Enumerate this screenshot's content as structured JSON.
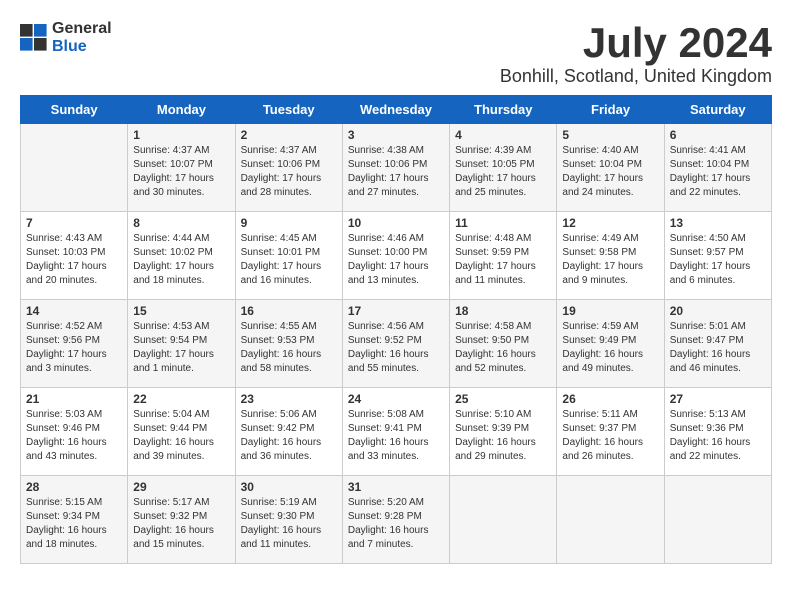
{
  "header": {
    "logo_general": "General",
    "logo_blue": "Blue",
    "month_title": "July 2024",
    "location": "Bonhill, Scotland, United Kingdom"
  },
  "weekdays": [
    "Sunday",
    "Monday",
    "Tuesday",
    "Wednesday",
    "Thursday",
    "Friday",
    "Saturday"
  ],
  "weeks": [
    [
      {
        "day": "",
        "sunrise": "",
        "sunset": "",
        "daylight": ""
      },
      {
        "day": "1",
        "sunrise": "Sunrise: 4:37 AM",
        "sunset": "Sunset: 10:07 PM",
        "daylight": "Daylight: 17 hours and 30 minutes."
      },
      {
        "day": "2",
        "sunrise": "Sunrise: 4:37 AM",
        "sunset": "Sunset: 10:06 PM",
        "daylight": "Daylight: 17 hours and 28 minutes."
      },
      {
        "day": "3",
        "sunrise": "Sunrise: 4:38 AM",
        "sunset": "Sunset: 10:06 PM",
        "daylight": "Daylight: 17 hours and 27 minutes."
      },
      {
        "day": "4",
        "sunrise": "Sunrise: 4:39 AM",
        "sunset": "Sunset: 10:05 PM",
        "daylight": "Daylight: 17 hours and 25 minutes."
      },
      {
        "day": "5",
        "sunrise": "Sunrise: 4:40 AM",
        "sunset": "Sunset: 10:04 PM",
        "daylight": "Daylight: 17 hours and 24 minutes."
      },
      {
        "day": "6",
        "sunrise": "Sunrise: 4:41 AM",
        "sunset": "Sunset: 10:04 PM",
        "daylight": "Daylight: 17 hours and 22 minutes."
      }
    ],
    [
      {
        "day": "7",
        "sunrise": "Sunrise: 4:43 AM",
        "sunset": "Sunset: 10:03 PM",
        "daylight": "Daylight: 17 hours and 20 minutes."
      },
      {
        "day": "8",
        "sunrise": "Sunrise: 4:44 AM",
        "sunset": "Sunset: 10:02 PM",
        "daylight": "Daylight: 17 hours and 18 minutes."
      },
      {
        "day": "9",
        "sunrise": "Sunrise: 4:45 AM",
        "sunset": "Sunset: 10:01 PM",
        "daylight": "Daylight: 17 hours and 16 minutes."
      },
      {
        "day": "10",
        "sunrise": "Sunrise: 4:46 AM",
        "sunset": "Sunset: 10:00 PM",
        "daylight": "Daylight: 17 hours and 13 minutes."
      },
      {
        "day": "11",
        "sunrise": "Sunrise: 4:48 AM",
        "sunset": "Sunset: 9:59 PM",
        "daylight": "Daylight: 17 hours and 11 minutes."
      },
      {
        "day": "12",
        "sunrise": "Sunrise: 4:49 AM",
        "sunset": "Sunset: 9:58 PM",
        "daylight": "Daylight: 17 hours and 9 minutes."
      },
      {
        "day": "13",
        "sunrise": "Sunrise: 4:50 AM",
        "sunset": "Sunset: 9:57 PM",
        "daylight": "Daylight: 17 hours and 6 minutes."
      }
    ],
    [
      {
        "day": "14",
        "sunrise": "Sunrise: 4:52 AM",
        "sunset": "Sunset: 9:56 PM",
        "daylight": "Daylight: 17 hours and 3 minutes."
      },
      {
        "day": "15",
        "sunrise": "Sunrise: 4:53 AM",
        "sunset": "Sunset: 9:54 PM",
        "daylight": "Daylight: 17 hours and 1 minute."
      },
      {
        "day": "16",
        "sunrise": "Sunrise: 4:55 AM",
        "sunset": "Sunset: 9:53 PM",
        "daylight": "Daylight: 16 hours and 58 minutes."
      },
      {
        "day": "17",
        "sunrise": "Sunrise: 4:56 AM",
        "sunset": "Sunset: 9:52 PM",
        "daylight": "Daylight: 16 hours and 55 minutes."
      },
      {
        "day": "18",
        "sunrise": "Sunrise: 4:58 AM",
        "sunset": "Sunset: 9:50 PM",
        "daylight": "Daylight: 16 hours and 52 minutes."
      },
      {
        "day": "19",
        "sunrise": "Sunrise: 4:59 AM",
        "sunset": "Sunset: 9:49 PM",
        "daylight": "Daylight: 16 hours and 49 minutes."
      },
      {
        "day": "20",
        "sunrise": "Sunrise: 5:01 AM",
        "sunset": "Sunset: 9:47 PM",
        "daylight": "Daylight: 16 hours and 46 minutes."
      }
    ],
    [
      {
        "day": "21",
        "sunrise": "Sunrise: 5:03 AM",
        "sunset": "Sunset: 9:46 PM",
        "daylight": "Daylight: 16 hours and 43 minutes."
      },
      {
        "day": "22",
        "sunrise": "Sunrise: 5:04 AM",
        "sunset": "Sunset: 9:44 PM",
        "daylight": "Daylight: 16 hours and 39 minutes."
      },
      {
        "day": "23",
        "sunrise": "Sunrise: 5:06 AM",
        "sunset": "Sunset: 9:42 PM",
        "daylight": "Daylight: 16 hours and 36 minutes."
      },
      {
        "day": "24",
        "sunrise": "Sunrise: 5:08 AM",
        "sunset": "Sunset: 9:41 PM",
        "daylight": "Daylight: 16 hours and 33 minutes."
      },
      {
        "day": "25",
        "sunrise": "Sunrise: 5:10 AM",
        "sunset": "Sunset: 9:39 PM",
        "daylight": "Daylight: 16 hours and 29 minutes."
      },
      {
        "day": "26",
        "sunrise": "Sunrise: 5:11 AM",
        "sunset": "Sunset: 9:37 PM",
        "daylight": "Daylight: 16 hours and 26 minutes."
      },
      {
        "day": "27",
        "sunrise": "Sunrise: 5:13 AM",
        "sunset": "Sunset: 9:36 PM",
        "daylight": "Daylight: 16 hours and 22 minutes."
      }
    ],
    [
      {
        "day": "28",
        "sunrise": "Sunrise: 5:15 AM",
        "sunset": "Sunset: 9:34 PM",
        "daylight": "Daylight: 16 hours and 18 minutes."
      },
      {
        "day": "29",
        "sunrise": "Sunrise: 5:17 AM",
        "sunset": "Sunset: 9:32 PM",
        "daylight": "Daylight: 16 hours and 15 minutes."
      },
      {
        "day": "30",
        "sunrise": "Sunrise: 5:19 AM",
        "sunset": "Sunset: 9:30 PM",
        "daylight": "Daylight: 16 hours and 11 minutes."
      },
      {
        "day": "31",
        "sunrise": "Sunrise: 5:20 AM",
        "sunset": "Sunset: 9:28 PM",
        "daylight": "Daylight: 16 hours and 7 minutes."
      },
      {
        "day": "",
        "sunrise": "",
        "sunset": "",
        "daylight": ""
      },
      {
        "day": "",
        "sunrise": "",
        "sunset": "",
        "daylight": ""
      },
      {
        "day": "",
        "sunrise": "",
        "sunset": "",
        "daylight": ""
      }
    ]
  ]
}
